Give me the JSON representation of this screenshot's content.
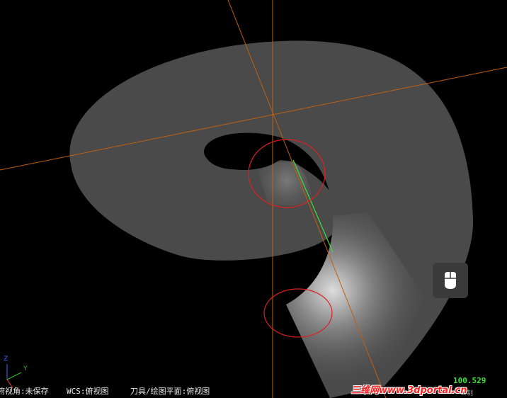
{
  "viewport": {
    "background": "#000000",
    "part_color": "#4a4a4a",
    "axis_color": "#c06010",
    "highlight_circle_color": "#dd2020",
    "edge_highlight_color": "#3ce03c"
  },
  "side_panel": {
    "icon": "mouse-icon"
  },
  "axis_gizmo": {
    "y_label": "Y",
    "z_label": "Z"
  },
  "status_bar": {
    "view_label": "俯视角:未保存",
    "wcs_label": "WCS:俯视图",
    "tool_plane_label": "刀具/绘图平面:俯视图"
  },
  "zoom_readout": "100.529",
  "unit_label": "公制",
  "watermark": "三维网www.3dportal.cn"
}
